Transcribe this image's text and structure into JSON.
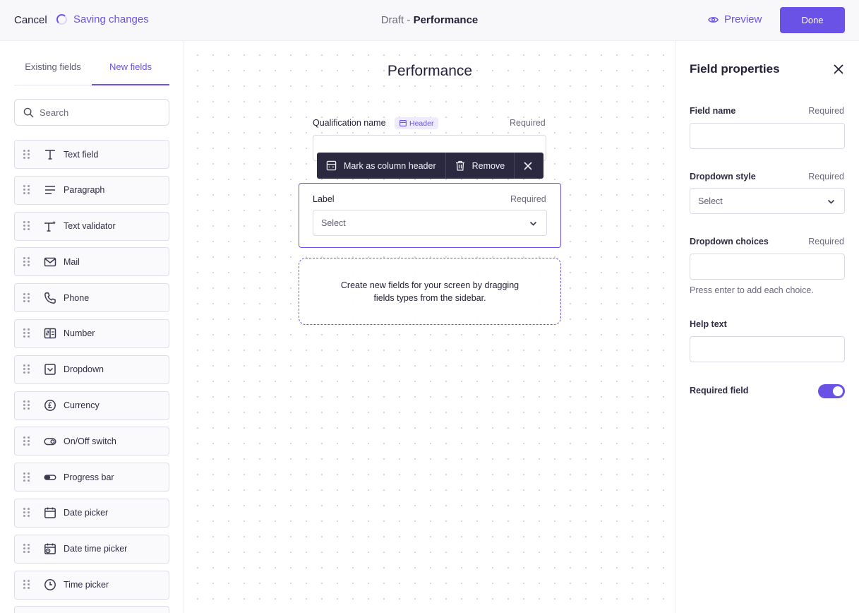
{
  "topbar": {
    "cancel_label": "Cancel",
    "saving_label": "Saving changes",
    "doc_prefix": "Draft - ",
    "doc_name": "Performance",
    "preview_label": "Preview",
    "done_label": "Done"
  },
  "sidebar": {
    "tabs": [
      {
        "label": "Existing fields",
        "active": false
      },
      {
        "label": "New fields",
        "active": true
      }
    ],
    "search_placeholder": "Search",
    "fields": [
      {
        "label": "Text field",
        "icon": "text-icon"
      },
      {
        "label": "Paragraph",
        "icon": "paragraph-icon"
      },
      {
        "label": "Text validator",
        "icon": "text-validator-icon"
      },
      {
        "label": "Mail",
        "icon": "mail-icon"
      },
      {
        "label": "Phone",
        "icon": "phone-icon"
      },
      {
        "label": "Number",
        "icon": "number-icon"
      },
      {
        "label": "Dropdown",
        "icon": "dropdown-icon"
      },
      {
        "label": "Currency",
        "icon": "currency-icon"
      },
      {
        "label": "On/Off switch",
        "icon": "switch-icon"
      },
      {
        "label": "Progress bar",
        "icon": "progress-icon"
      },
      {
        "label": "Date picker",
        "icon": "calendar-icon"
      },
      {
        "label": "Date time picker",
        "icon": "calendar-clock-icon"
      },
      {
        "label": "Time picker",
        "icon": "clock-icon"
      }
    ]
  },
  "canvas": {
    "title": "Performance",
    "qualification": {
      "label": "Qualification name",
      "badge": "Header",
      "required": "Required"
    },
    "toolbar": {
      "mark_label": "Mark as column header",
      "remove_label": "Remove"
    },
    "label_field": {
      "label": "Label",
      "required": "Required",
      "select_value": "Select"
    },
    "dropzone_text": "Create new fields for your screen by dragging fields types from the sidebar."
  },
  "properties": {
    "title": "Field properties",
    "field_name": {
      "label": "Field name",
      "required": "Required",
      "value": ""
    },
    "dropdown_style": {
      "label": "Dropdown style",
      "required": "Required",
      "value": "Select"
    },
    "dropdown_choices": {
      "label": "Dropdown choices",
      "required": "Required",
      "value": "",
      "hint": "Press enter to add each choice."
    },
    "help_text": {
      "label": "Help text",
      "value": ""
    },
    "required_field": {
      "label": "Required field",
      "enabled": true
    }
  },
  "colors": {
    "accent": "#6a52e6",
    "toolbar_bg": "#2a2940",
    "text": "#23223a",
    "muted": "#6a6a80"
  }
}
